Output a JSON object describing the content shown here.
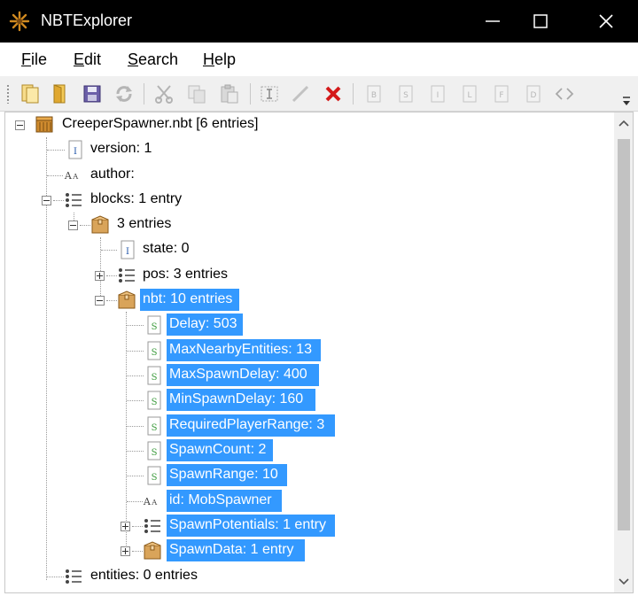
{
  "window": {
    "title": "NBTExplorer"
  },
  "menu": [
    {
      "label": "File",
      "underline": "F",
      "rest": "ile"
    },
    {
      "label": "Edit",
      "underline": "E",
      "rest": "dit"
    },
    {
      "label": "Search",
      "underline": "S",
      "rest": "earch"
    },
    {
      "label": "Help",
      "underline": "H",
      "rest": "elp"
    }
  ],
  "toolbar": {
    "buttons": [
      "open-file-icon",
      "open-folder-icon",
      "save-icon",
      "refresh-icon",
      "cut-icon",
      "copy-icon",
      "paste-icon",
      "rename-icon",
      "edit-icon",
      "delete-icon",
      "add-byte-icon",
      "add-short-icon",
      "add-int-icon",
      "add-long-icon",
      "add-float-icon",
      "add-double-icon",
      "add-bytearray-icon"
    ]
  },
  "tree": {
    "nodes": [
      {
        "id": "root",
        "text": "CreeperSpawner.nbt [6 entries]",
        "icon": "nbt-file-icon",
        "selected": false
      },
      {
        "id": "version",
        "text": "version: 1",
        "icon": "int-tag-icon",
        "selected": false
      },
      {
        "id": "author",
        "text": "author:",
        "icon": "string-tag-icon",
        "selected": false
      },
      {
        "id": "blocks",
        "text": "blocks: 1 entry",
        "icon": "list-tag-icon",
        "selected": false
      },
      {
        "id": "compound",
        "text": "3 entries",
        "icon": "compound-tag-icon",
        "selected": false
      },
      {
        "id": "state",
        "text": "state: 0",
        "icon": "int-tag-icon",
        "selected": false
      },
      {
        "id": "pos",
        "text": "pos: 3 entries",
        "icon": "list-tag-icon",
        "selected": false
      },
      {
        "id": "nbt",
        "text": "nbt: 10 entries",
        "icon": "compound-tag-icon",
        "selected": true
      },
      {
        "id": "delay",
        "text": "Delay: 503",
        "icon": "short-tag-icon",
        "selected": true
      },
      {
        "id": "maxnearby",
        "text": "MaxNearbyEntities: 13",
        "icon": "short-tag-icon",
        "selected": true
      },
      {
        "id": "maxspawn",
        "text": "MaxSpawnDelay: 400",
        "icon": "short-tag-icon",
        "selected": true
      },
      {
        "id": "minspawn",
        "text": "MinSpawnDelay: 160",
        "icon": "short-tag-icon",
        "selected": true
      },
      {
        "id": "reqplayer",
        "text": "RequiredPlayerRange: 3",
        "icon": "short-tag-icon",
        "selected": true
      },
      {
        "id": "spawncount",
        "text": "SpawnCount: 2",
        "icon": "short-tag-icon",
        "selected": true
      },
      {
        "id": "spawnrange",
        "text": "SpawnRange: 10",
        "icon": "short-tag-icon",
        "selected": true
      },
      {
        "id": "idnode",
        "text": "id: MobSpawner",
        "icon": "string-tag-icon",
        "selected": true
      },
      {
        "id": "potentials",
        "text": "SpawnPotentials: 1 entry",
        "icon": "list-tag-icon",
        "selected": true
      },
      {
        "id": "spawndata",
        "text": "SpawnData: 1 entry",
        "icon": "compound-tag-icon",
        "selected": true
      },
      {
        "id": "entities",
        "text": "entities: 0 entries",
        "icon": "list-tag-icon",
        "selected": false
      }
    ]
  },
  "colors": {
    "selection": "#3399ff",
    "titlebar": "#000000"
  }
}
